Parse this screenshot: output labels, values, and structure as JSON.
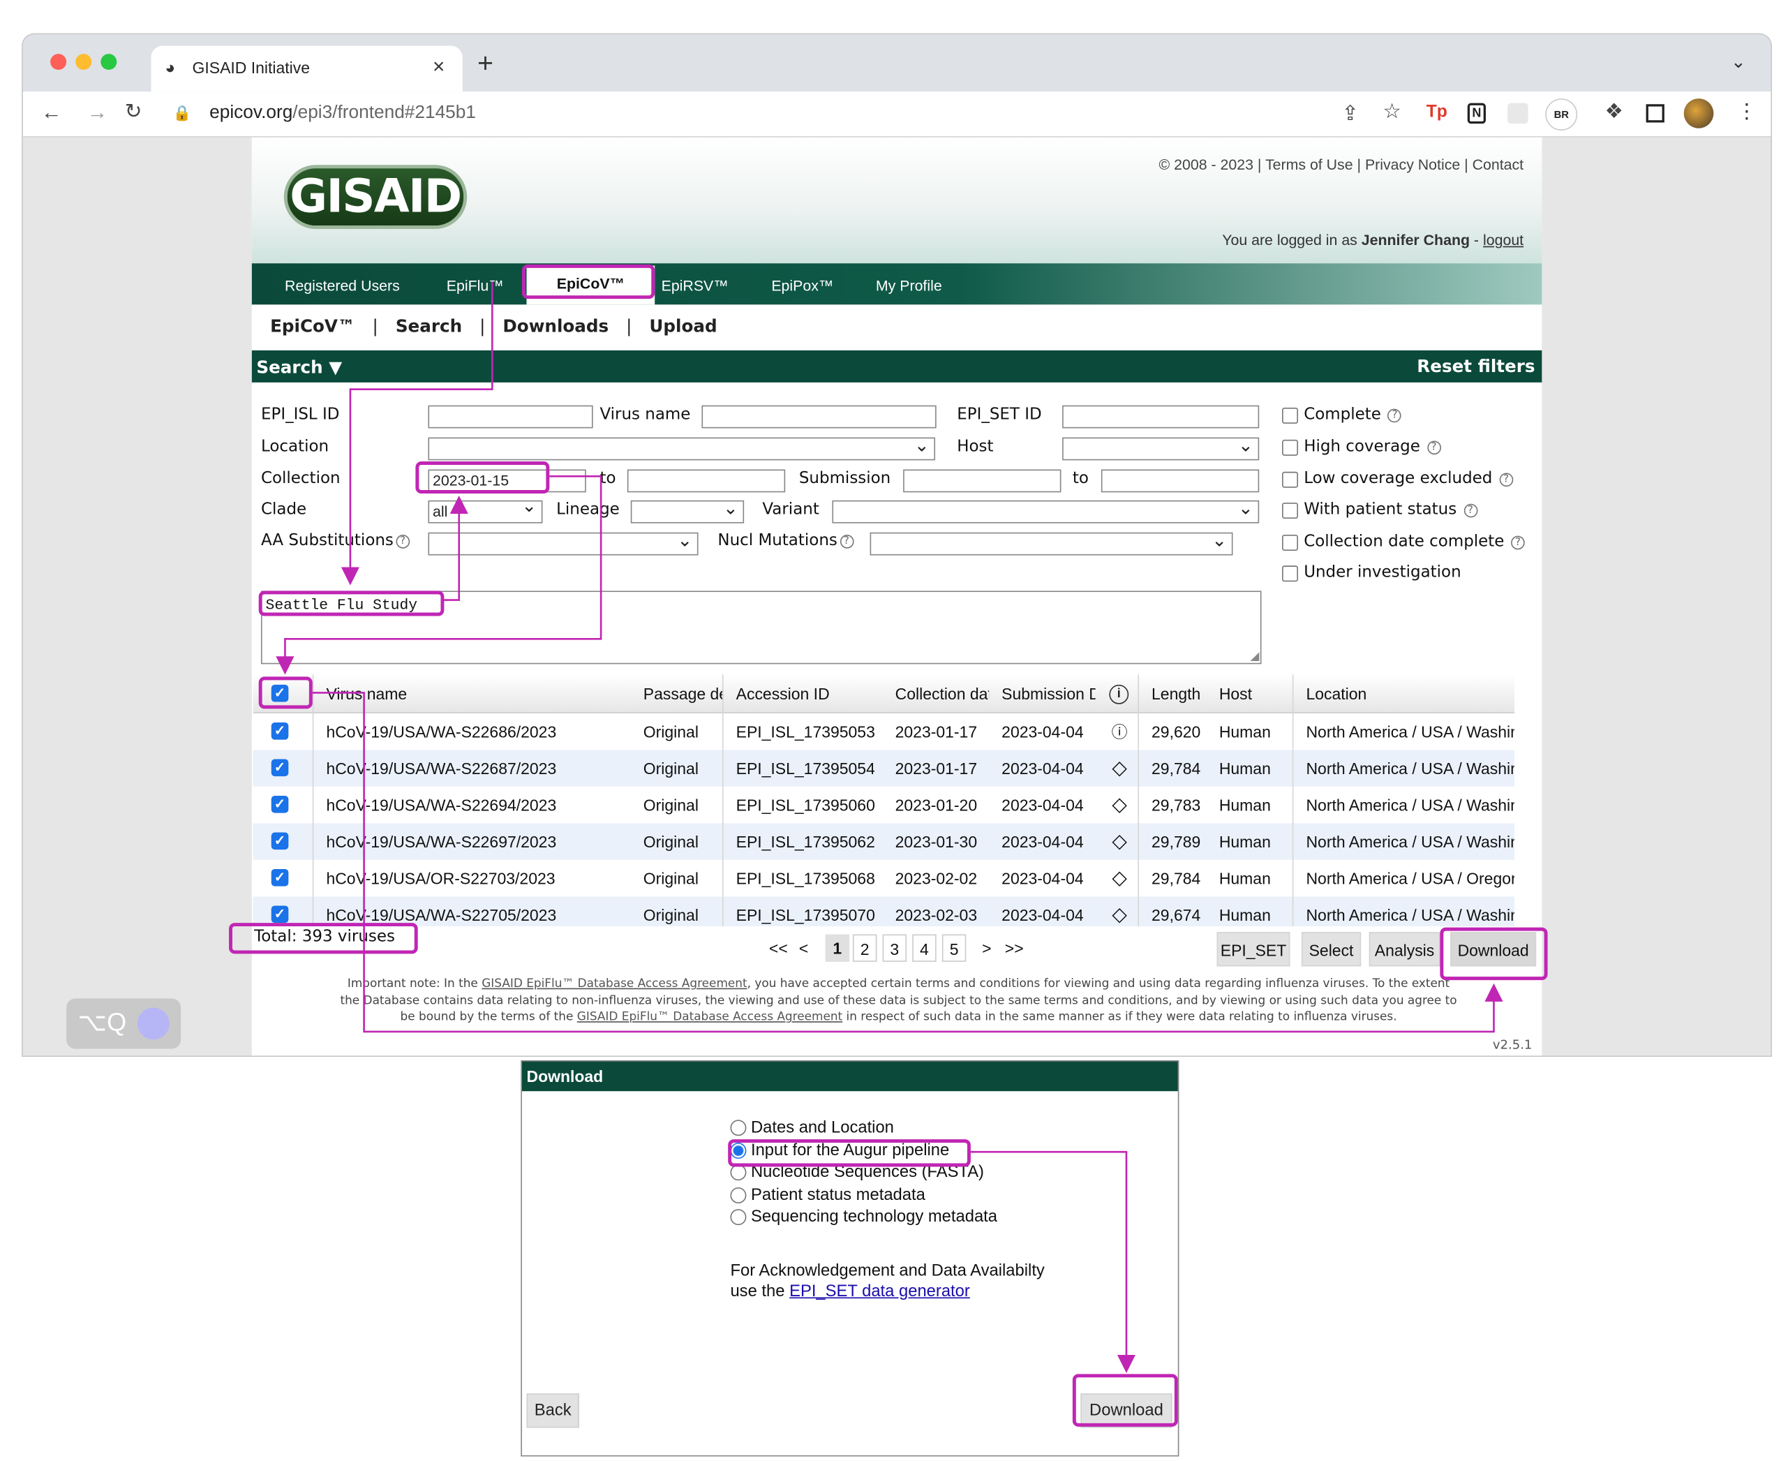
{
  "browser": {
    "tab_title": "GISAID Initiative",
    "close_label": "×",
    "new_tab_label": "+",
    "url_domain": "epicov.org",
    "url_path": "/epi3/frontend#2145b1",
    "ext_badge": "BR",
    "overlay_label": "⌥Q"
  },
  "site": {
    "logo_text": "GISAID",
    "footer_links": "© 2008 - 2023 | Terms of Use | Privacy Notice | Contact",
    "logged_in_prefix": "You are logged in as",
    "user_name": "Jennifer Chang",
    "logout_sep": "-",
    "logout_label": "logout",
    "nav_tabs": [
      "Registered Users",
      "EpiFlu™",
      "EpiCoV™",
      "EpiRSV™",
      "EpiPox™",
      "My Profile"
    ],
    "active_tab": "EpiCoV™",
    "subnav": [
      "EpiCoV™",
      "Search",
      "Downloads",
      "Upload"
    ],
    "separator": "|",
    "version": "v2.5.1"
  },
  "search": {
    "header_label": "Search ▼",
    "reset_label": "Reset filters",
    "labels": {
      "epi_isl": "EPI_ISL ID",
      "virus_name": "Virus name",
      "epi_set": "EPI_SET ID",
      "location": "Location",
      "host": "Host",
      "collection": "Collection",
      "to": "to",
      "submission": "Submission",
      "clade": "Clade",
      "lineage": "Lineage",
      "variant": "Variant",
      "aa_subs": "AA Substitutions",
      "nucl_mut": "Nucl Mutations"
    },
    "collection_from": "2023-01-15",
    "clade_value": "all",
    "text_query": "Seattle Flu Study",
    "checkboxes": [
      "Complete",
      "High coverage",
      "Low coverage excluded",
      "With patient status",
      "Collection date complete",
      "Under investigation"
    ],
    "help_glyph": "?"
  },
  "table": {
    "headers": [
      "Virus name",
      "Passage de",
      "Accession ID",
      "Collection dat",
      "Submission D",
      "Length",
      "Host",
      "Location"
    ],
    "rows": [
      {
        "name": "hCoV-19/USA/WA-S22686/2023",
        "passage": "Original",
        "accession": "EPI_ISL_17395053",
        "collection": "2023-01-17",
        "submission": "2023-04-04",
        "flag": "info",
        "length": "29,620",
        "host": "Human",
        "location": "North America / USA / Washin"
      },
      {
        "name": "hCoV-19/USA/WA-S22687/2023",
        "passage": "Original",
        "accession": "EPI_ISL_17395054",
        "collection": "2023-01-17",
        "submission": "2023-04-04",
        "flag": "warn",
        "length": "29,784",
        "host": "Human",
        "location": "North America / USA / Washin"
      },
      {
        "name": "hCoV-19/USA/WA-S22694/2023",
        "passage": "Original",
        "accession": "EPI_ISL_17395060",
        "collection": "2023-01-20",
        "submission": "2023-04-04",
        "flag": "warn",
        "length": "29,783",
        "host": "Human",
        "location": "North America / USA / Washin"
      },
      {
        "name": "hCoV-19/USA/WA-S22697/2023",
        "passage": "Original",
        "accession": "EPI_ISL_17395062",
        "collection": "2023-01-30",
        "submission": "2023-04-04",
        "flag": "warn",
        "length": "29,789",
        "host": "Human",
        "location": "North America / USA / Washin"
      },
      {
        "name": "hCoV-19/USA/OR-S22703/2023",
        "passage": "Original",
        "accession": "EPI_ISL_17395068",
        "collection": "2023-02-02",
        "submission": "2023-04-04",
        "flag": "warn",
        "length": "29,784",
        "host": "Human",
        "location": "North America / USA / Oregor"
      },
      {
        "name": "hCoV-19/USA/WA-S22705/2023",
        "passage": "Original",
        "accession": "EPI_ISL_17395070",
        "collection": "2023-02-03",
        "submission": "2023-04-04",
        "flag": "warn",
        "length": "29,674",
        "host": "Human",
        "location": "North America / USA / Washin"
      }
    ],
    "total": "Total: 393 viruses",
    "pager": {
      "first": "<<",
      "prev": "<",
      "pages": [
        "1",
        "2",
        "3",
        "4",
        "5"
      ],
      "current": "1",
      "next": ">",
      "last": ">>"
    },
    "buttons": [
      "EPI_SET",
      "Select",
      "Analysis",
      "Download"
    ]
  },
  "notice": {
    "line1_a": "Important note: In the ",
    "link1": "GISAID EpiFlu™ Database Access Agreement",
    "line1_b": ", you have accepted certain terms and conditions for viewing and using data regarding influenza viruses. To the extent",
    "line2": "the Database contains data relating to non-influenza viruses, the viewing and use of these data is subject to the same terms and conditions, and by viewing or using such data you agree to",
    "line3_a": "be bound by the terms of the ",
    "link2": "GISAID EpiFlu™ Database Access Agreement",
    "line3_b": " in respect of such data in the same manner as if they were data relating to influenza viruses."
  },
  "dialog": {
    "title": "Download",
    "options": [
      "Dates and Location",
      "Input for the Augur pipeline",
      "Nucleotide Sequences (FASTA)",
      "Patient status metadata",
      "Sequencing technology metadata"
    ],
    "selected": "Input for the Augur pipeline",
    "ack_line1": "For Acknowledgement and Data Availabilty",
    "ack_line2_prefix": "use the",
    "ack_link": "EPI_SET data generator",
    "back_label": "Back",
    "download_label": "Download"
  },
  "colors": {
    "highlight": "#c026b4",
    "nav_green": "#0b4a3a",
    "teal": "#0b4a3a",
    "checkbox_blue": "#1a73e8",
    "row_alt": "#eaf1fb",
    "link_blue": "#1a0dab"
  }
}
